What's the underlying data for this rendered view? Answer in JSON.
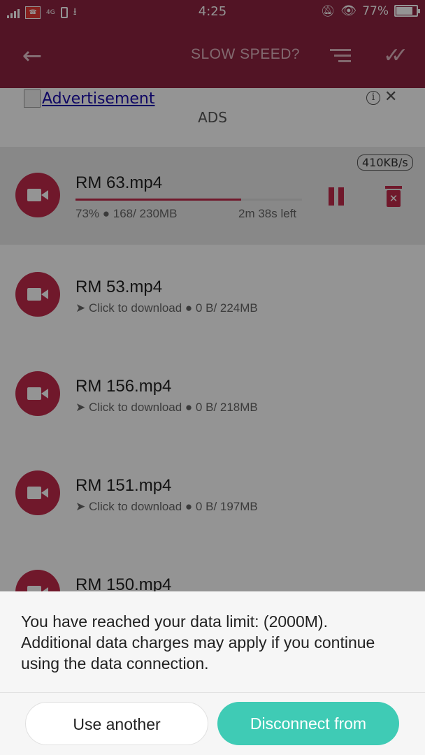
{
  "status_bar": {
    "network_label": "4G",
    "time": "4:25",
    "battery": "77%"
  },
  "toolbar": {
    "title": "SLOW SPEED?"
  },
  "ad": {
    "link_text": "Advertisement",
    "label": "ADS"
  },
  "downloads": [
    {
      "name": "RM 63.mp4",
      "percent": "73%",
      "size": "168/ 230MB",
      "time_left": "2m 38s left",
      "speed": "410KB/s",
      "progress": 0.73
    },
    {
      "name": "RM 53.mp4",
      "action": "➤ Click to download",
      "size": "0 B/ 224MB"
    },
    {
      "name": "RM 156.mp4",
      "action": "➤ Click to download",
      "size": "0 B/ 218MB"
    },
    {
      "name": "RM 151.mp4",
      "action": "➤ Click to download",
      "size": "0 B/ 197MB"
    },
    {
      "name": "RM 150.mp4"
    }
  ],
  "dialog": {
    "message": "You have reached your data limit: (2000M). Additional data charges may apply if you continue using the data connection.",
    "use_another": "Use another",
    "disconnect": "Disconnect from"
  },
  "colors": {
    "toolbar": "#8e2440",
    "accent": "#c22a4a",
    "disconnect_button": "#3fcbb5"
  }
}
